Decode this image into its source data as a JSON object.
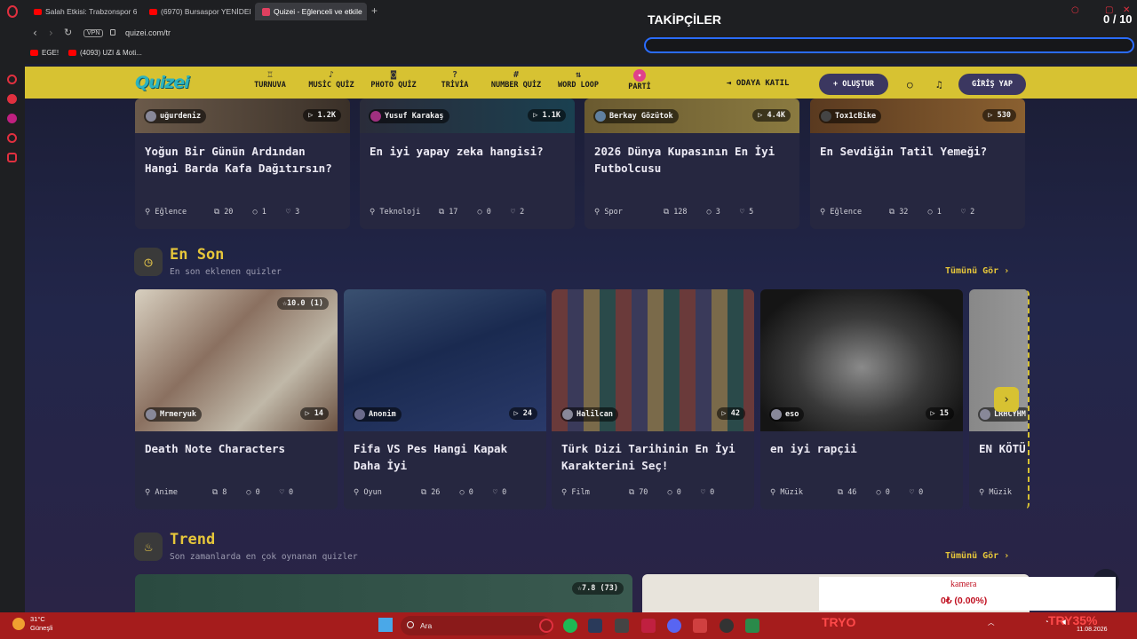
{
  "browser": {
    "tabs": [
      {
        "label": "Salah Etkisi: Trabzonspor 6",
        "active": false
      },
      {
        "label": "(6970) Bursaspor YENİDEN",
        "active": false
      },
      {
        "label": "Quizei - Eğlenceli ve etkile",
        "active": true
      }
    ],
    "url": "quizei.com/tr",
    "vpn": "VPN",
    "bookmarks": [
      "EGE!",
      "(4093) UZI & Moti..."
    ]
  },
  "overlay": {
    "title": "TAKİPÇİLER",
    "count": "0 / 10"
  },
  "nav": {
    "logo": "Quizei",
    "items": [
      {
        "label": "TURNUVA",
        "icon": "trophy-icon",
        "glyph": "♖"
      },
      {
        "label": "MUSİC QUİZ",
        "icon": "music-note-icon",
        "glyph": "♪"
      },
      {
        "label": "PHOTO QUİZ",
        "icon": "camera-icon",
        "glyph": "◙"
      },
      {
        "label": "TRİVİA",
        "icon": "question-bubble-icon",
        "glyph": "?"
      },
      {
        "label": "NUMBER QUİZ",
        "icon": "hash-icon",
        "glyph": "#"
      },
      {
        "label": "WORD LOOP",
        "icon": "sort-icon",
        "glyph": "⇅"
      },
      {
        "label": "PARTİ",
        "icon": "party-icon",
        "glyph": "✦"
      }
    ],
    "join_label": "ODAYA KATIL",
    "create_label": "+ OLUŞTUR",
    "login_label": "GİRİŞ YAP"
  },
  "top_cards": [
    {
      "author": "uğurdeniz",
      "plays": "1.2K",
      "title": "Yoğun Bir Günün Ardından Hangi Barda Kafa Dağıtırsın?",
      "category": "Eğlence",
      "questions": "20",
      "comments": "1",
      "likes": "3"
    },
    {
      "author": "Yusuf Karakaş",
      "plays": "1.1K",
      "title": "En iyi yapay zeka hangisi?",
      "category": "Teknoloji",
      "questions": "17",
      "comments": "0",
      "likes": "2"
    },
    {
      "author": "Berkay Gözütok",
      "plays": "4.4K",
      "title": "2026 Dünya Kupasının En İyi Futbolcusu",
      "category": "Spor",
      "questions": "128",
      "comments": "3",
      "likes": "5"
    },
    {
      "author": "Tox1cBike",
      "plays": "530",
      "title": "En Sevdiğin Tatil Yemeği?",
      "category": "Eğlence",
      "questions": "32",
      "comments": "1",
      "likes": "2"
    }
  ],
  "latest": {
    "title": "En Son",
    "subtitle": "En son eklenen quizler",
    "see_all": "Tümünü Gör ›",
    "cards": [
      {
        "author": "Mrmeryuk",
        "plays": "14",
        "rating": "☆10.0 (1)",
        "title": "Death Note Characters",
        "category": "Anime",
        "questions": "8",
        "comments": "0",
        "likes": "0"
      },
      {
        "author": "Anonim",
        "plays": "24",
        "title": "Fifa VS Pes Hangi Kapak Daha İyi",
        "category": "Oyun",
        "questions": "26",
        "comments": "0",
        "likes": "0"
      },
      {
        "author": "Halilcan",
        "plays": "42",
        "title": "Türk Dizi Tarihinin En İyi Karakterini Seç!",
        "category": "Film",
        "questions": "70",
        "comments": "0",
        "likes": "0"
      },
      {
        "author": "eso",
        "plays": "15",
        "title": "en iyi rapçii",
        "category": "Müzik",
        "questions": "46",
        "comments": "0",
        "likes": "0"
      },
      {
        "author": "LRHCYHM",
        "title": "EN KÖTÜ",
        "category": "Müzik"
      }
    ]
  },
  "trend": {
    "title": "Trend",
    "subtitle": "Son zamanlarda en çok oynanan quizler",
    "see_all": "Tümünü Gör ›",
    "rating": "☆7.8 (73)"
  },
  "kamera": {
    "label": "kamera",
    "value": "0₺ (0.00%)"
  },
  "taskbar": {
    "weather_temp": "31°C",
    "weather_desc": "Güneşli",
    "search": "Ara",
    "tray_left": "TRYO",
    "tray_right": "TRY35%",
    "date": "11.08.2026"
  }
}
